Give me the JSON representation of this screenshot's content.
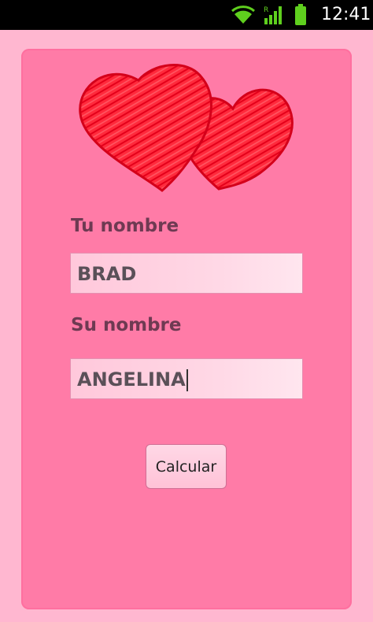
{
  "status_bar": {
    "time": "12:41",
    "icons": [
      "wifi-icon",
      "signal-icon",
      "battery-icon"
    ]
  },
  "form": {
    "label1": "Tu nombre",
    "value1": "BRAD",
    "label2": "Su nombre",
    "value2": "ANGELINA",
    "button": "Calcular"
  },
  "colors": {
    "background": "#ffb7d0",
    "card": "#ff7ba7",
    "heart": "#ff1a2e",
    "label": "#6e3a52"
  }
}
